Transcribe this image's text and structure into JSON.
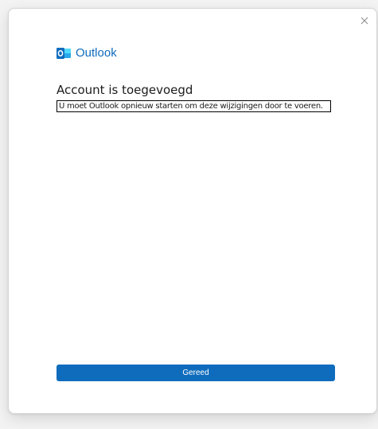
{
  "brand": {
    "name": "Outlook",
    "icon": "outlook-logo-icon",
    "color": "#0f6cbd"
  },
  "dialog": {
    "title": "Account is toegevoegd",
    "message": "U moet Outlook opnieuw starten om deze wijzigingen door te voeren.",
    "close_icon": "close-icon"
  },
  "actions": {
    "done_label": "Gereed",
    "done_color": "#0f6cbd"
  }
}
